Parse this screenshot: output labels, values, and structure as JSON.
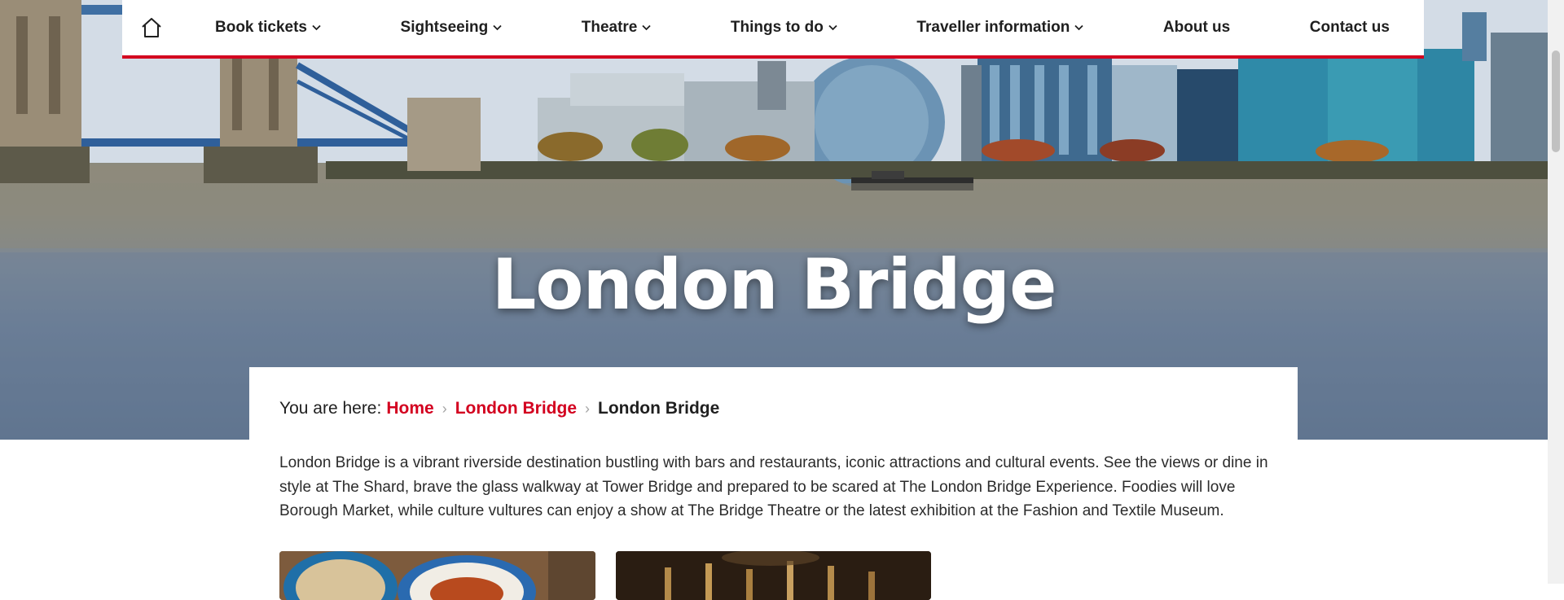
{
  "nav": {
    "home_icon": "home-icon",
    "items": [
      {
        "label": "Book tickets",
        "has_dropdown": true
      },
      {
        "label": "Sightseeing",
        "has_dropdown": true
      },
      {
        "label": "Theatre",
        "has_dropdown": true
      },
      {
        "label": "Things to do",
        "has_dropdown": true
      },
      {
        "label": "Traveller information",
        "has_dropdown": true
      },
      {
        "label": "About us",
        "has_dropdown": false
      },
      {
        "label": "Contact us",
        "has_dropdown": false
      }
    ]
  },
  "hero": {
    "title": "London Bridge"
  },
  "breadcrumb": {
    "prefix": "You are here:",
    "links": [
      "Home",
      "London Bridge"
    ],
    "current": "London Bridge"
  },
  "intro": {
    "text": "London Bridge is a vibrant riverside destination bustling with bars and restaurants, iconic attractions and cultural events. See the views or dine in style at The Shard, brave the glass walkway at Tower Bridge and prepared to be scared at The London Bridge Experience. Foodies will love Borough Market, while culture vultures can enjoy a show at The Bridge Theatre or the latest exhibition at the Fashion and Textile Museum."
  },
  "colors": {
    "accent": "#d3001f",
    "text": "#1f1f1f"
  }
}
